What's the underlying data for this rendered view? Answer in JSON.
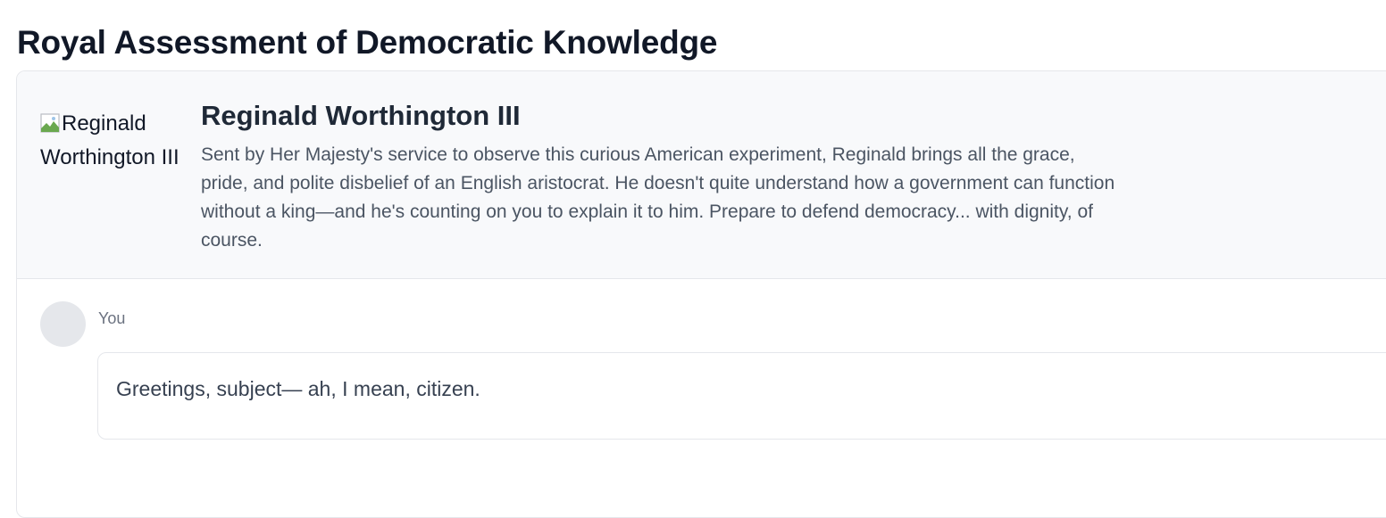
{
  "page": {
    "title": "Royal Assessment of Democratic Knowledge"
  },
  "profile": {
    "image_alt": "Reginald Worthington III",
    "name": "Reginald Worthington III",
    "description": "Sent by Her Majesty's service to observe this curious American experiment, Reginald brings all the grace, pride, and polite disbelief of an English aristocrat. He doesn't quite understand how a government can function without a king—and he's counting on you to explain it to him. Prepare to defend democracy... with dignity, of course."
  },
  "chat": {
    "messages": [
      {
        "sender": "You",
        "text": "Greetings, subject— ah, I mean, citizen."
      }
    ]
  },
  "colors": {
    "title": "#111827",
    "profile_background": "#f8f9fb",
    "border": "#e5e7eb",
    "muted_text": "#6b7280",
    "body_text": "#4b5563"
  },
  "icons": {
    "broken_image": "broken-image-icon"
  }
}
